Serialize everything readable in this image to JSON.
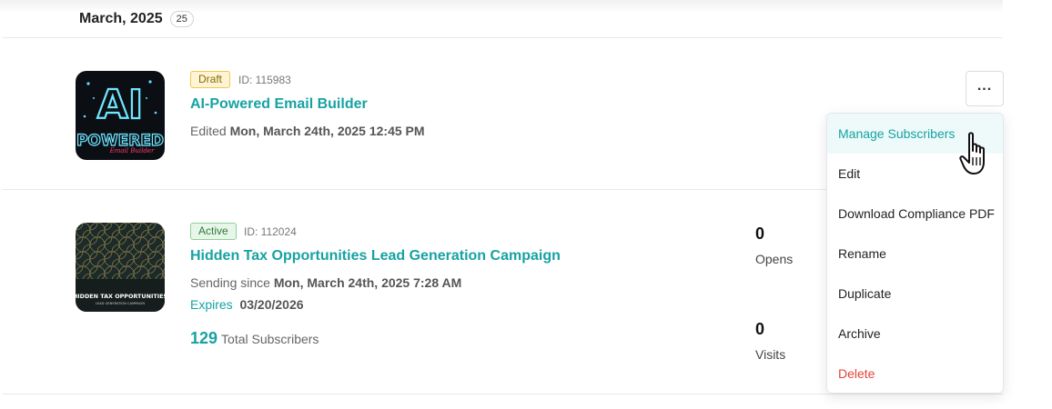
{
  "month_group": {
    "title": "March, 2025",
    "count": "25"
  },
  "campaigns": [
    {
      "thumbnail": {
        "lines": [
          "AI",
          "POWERED"
        ],
        "script": "Email Builder"
      },
      "status": "Draft",
      "id_text": "ID: 115983",
      "title": "AI-Powered Email Builder",
      "meta_label": "Edited",
      "meta_value": "Mon, March 24th, 2025 12:45 PM"
    },
    {
      "thumbnail": {
        "lines": [
          "HIDDEN TAX OPPORTUNITIES"
        ],
        "script": "LEAD GENERATION CAMPAIGN"
      },
      "status": "Active",
      "id_text": "ID: 112024",
      "title": "Hidden Tax Opportunities Lead Generation Campaign",
      "meta_label": "Sending since",
      "meta_value": "Mon, March 24th, 2025 7:28 AM",
      "expires_label": "Expires",
      "expires_value": "03/20/2026",
      "subscribers_count": "129",
      "subscribers_label": "Total Subscribers",
      "stats": [
        {
          "value": "0",
          "label": "Opens"
        },
        {
          "value": "0",
          "label": "Visits"
        }
      ]
    }
  ],
  "more_button": {
    "label": "..."
  },
  "menu": {
    "items": [
      {
        "label": "Manage Subscribers",
        "state": "hover"
      },
      {
        "label": "Edit"
      },
      {
        "label": "Download Compliance PDF"
      },
      {
        "label": "Rename"
      },
      {
        "label": "Duplicate"
      },
      {
        "label": "Archive"
      },
      {
        "label": "Delete",
        "style": "danger"
      }
    ]
  },
  "colors": {
    "accent": "#17a2a2",
    "draft_badge": "#fff5d6",
    "active_badge": "#e8f6e9",
    "danger": "#e0463c"
  },
  "icons": {
    "more": "more-horizontal-icon",
    "cursor": "hand-pointer-icon"
  }
}
